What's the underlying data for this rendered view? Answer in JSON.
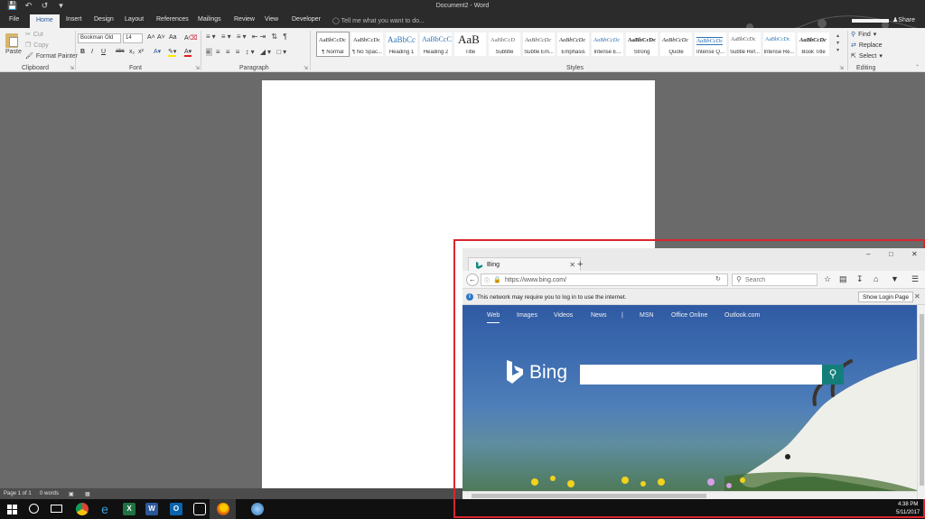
{
  "window": {
    "title": "Document2 - Word"
  },
  "tabs": [
    "File",
    "Home",
    "Insert",
    "Design",
    "Layout",
    "References",
    "Mailings",
    "Review",
    "View",
    "Developer"
  ],
  "tell_me": "Tell me what you want to do...",
  "share": "Share",
  "ribbon": {
    "clipboard": {
      "label": "Clipboard",
      "paste": "Paste",
      "cut": "Cut",
      "copy": "Copy",
      "format_painter": "Format Painter"
    },
    "font": {
      "label": "Font",
      "name": "Bookman Old",
      "size": "14",
      "bold": "B",
      "italic": "I",
      "underline": "U",
      "strike": "abc",
      "sub": "x₂",
      "sup": "x²",
      "grow": "A˄",
      "shrink": "A˅",
      "case": "Aa",
      "clear": "A"
    },
    "paragraph": {
      "label": "Paragraph"
    },
    "styles": {
      "label": "Styles",
      "items": [
        {
          "sample": "AaBbCcDc",
          "name": "¶ Normal"
        },
        {
          "sample": "AaBbCcDc",
          "name": "¶ No Spac..."
        },
        {
          "sample": "AaBbCc",
          "name": "Heading 1"
        },
        {
          "sample": "AaBbCcC",
          "name": "Heading 2"
        },
        {
          "sample": "AaB",
          "name": "Title"
        },
        {
          "sample": "AaBbCcD",
          "name": "Subtitle"
        },
        {
          "sample": "AaBbCcDc",
          "name": "Subtle Em..."
        },
        {
          "sample": "AaBbCcDc",
          "name": "Emphasis"
        },
        {
          "sample": "AaBbCcDc",
          "name": "Intense E..."
        },
        {
          "sample": "AaBbCcDc",
          "name": "Strong"
        },
        {
          "sample": "AaBbCcDc",
          "name": "Quote"
        },
        {
          "sample": "AaBbCcDc",
          "name": "Intense Q..."
        },
        {
          "sample": "AaBbCcDc",
          "name": "Subtle Ref..."
        },
        {
          "sample": "AaBbCcDc",
          "name": "Intense Re..."
        },
        {
          "sample": "AaBbCcDc",
          "name": "Book Title"
        }
      ]
    },
    "editing": {
      "label": "Editing",
      "find": "Find",
      "replace": "Replace",
      "select": "Select"
    }
  },
  "statusbar": {
    "page": "Page 1 of 1",
    "words": "0 words"
  },
  "clock": {
    "time": "4:38 PM",
    "date": "5/11/2017"
  },
  "browser": {
    "tab_title": "Bing",
    "url": "https://www.bing.com/",
    "search_placeholder": "Search",
    "notification": "This network may require you to log in to use the internet.",
    "notification_button": "Show Login Page",
    "bing_nav": [
      "Web",
      "Images",
      "Videos",
      "News",
      "|",
      "MSN",
      "Office Online",
      "Outlook.com"
    ],
    "logo_text": "Bing"
  },
  "colors": {
    "accent": "#2b579a",
    "frame": "#d9262c",
    "bing_teal": "#147f7a"
  }
}
